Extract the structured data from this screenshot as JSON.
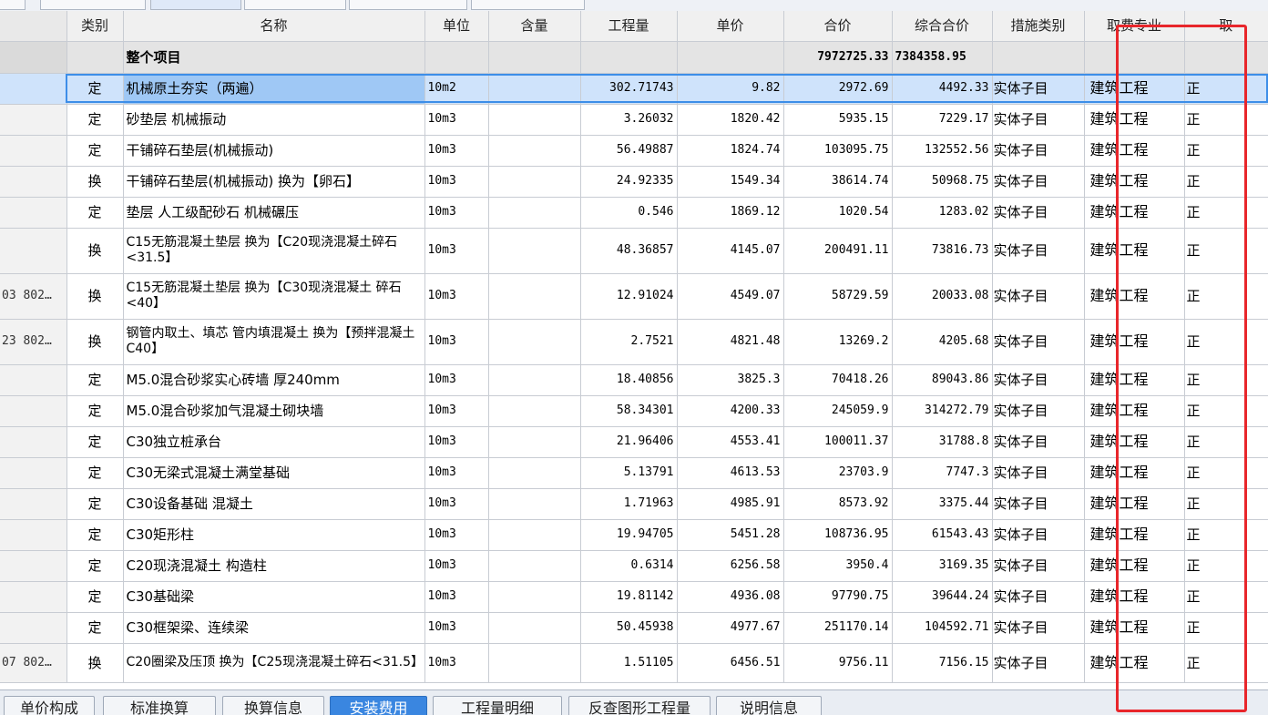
{
  "columns": {
    "category": "类别",
    "name": "名称",
    "unit": "单位",
    "content": "含量",
    "quantity": "工程量",
    "unit_price": "单价",
    "total_price": "合价",
    "combined_total": "综合合价",
    "measure_type": "措施类别",
    "fee_specialty": "取费专业",
    "extra": "取"
  },
  "project_row": {
    "name": "整个项目",
    "total_price": "7972725.33",
    "combined_total": "7384358.95"
  },
  "rows": [
    {
      "idx": "",
      "category": "定",
      "name": "机械原土夯实（两遍）",
      "unit": "10m2",
      "content": "",
      "quantity": "302.71743",
      "unit_price": "9.82",
      "total_price": "2972.69",
      "combined_total": "4492.33",
      "measure_type": "实体子目",
      "fee_specialty": "建筑工程",
      "extra": "正"
    },
    {
      "idx": "",
      "category": "定",
      "name": "砂垫层 机械振动",
      "unit": "10m3",
      "content": "",
      "quantity": "3.26032",
      "unit_price": "1820.42",
      "total_price": "5935.15",
      "combined_total": "7229.17",
      "measure_type": "实体子目",
      "fee_specialty": "建筑工程",
      "extra": "正"
    },
    {
      "idx": "",
      "category": "定",
      "name": "干铺碎石垫层(机械振动)",
      "unit": "10m3",
      "content": "",
      "quantity": "56.49887",
      "unit_price": "1824.74",
      "total_price": "103095.75",
      "combined_total": "132552.56",
      "measure_type": "实体子目",
      "fee_specialty": "建筑工程",
      "extra": "正"
    },
    {
      "idx": "",
      "category": "换",
      "name": "干铺碎石垫层(机械振动)  换为【卵石】",
      "unit": "10m3",
      "content": "",
      "quantity": "24.92335",
      "unit_price": "1549.34",
      "total_price": "38614.74",
      "combined_total": "50968.75",
      "measure_type": "实体子目",
      "fee_specialty": "建筑工程",
      "extra": "正"
    },
    {
      "idx": "",
      "category": "定",
      "name": "垫层 人工级配砂石 机械碾压",
      "unit": "10m3",
      "content": "",
      "quantity": "0.546",
      "unit_price": "1869.12",
      "total_price": "1020.54",
      "combined_total": "1283.02",
      "measure_type": "实体子目",
      "fee_specialty": "建筑工程",
      "extra": "正"
    },
    {
      "idx": "",
      "category": "换",
      "name": "C15无筋混凝土垫层  换为【C20现浇混凝土碎石<31.5】",
      "unit": "10m3",
      "content": "",
      "quantity": "48.36857",
      "unit_price": "4145.07",
      "total_price": "200491.11",
      "combined_total": "73816.73",
      "measure_type": "实体子目",
      "fee_specialty": "建筑工程",
      "extra": "正"
    },
    {
      "idx": "03 802…",
      "category": "换",
      "name": "C15无筋混凝土垫层  换为【C30现浇混凝土 碎石<40】",
      "unit": "10m3",
      "content": "",
      "quantity": "12.91024",
      "unit_price": "4549.07",
      "total_price": "58729.59",
      "combined_total": "20033.08",
      "measure_type": "实体子目",
      "fee_specialty": "建筑工程",
      "extra": "正"
    },
    {
      "idx": "23 802…",
      "category": "换",
      "name": "钢管内取土、填芯 管内填混凝土  换为【预拌混凝土 C40】",
      "unit": "10m3",
      "content": "",
      "quantity": "2.7521",
      "unit_price": "4821.48",
      "total_price": "13269.2",
      "combined_total": "4205.68",
      "measure_type": "实体子目",
      "fee_specialty": "建筑工程",
      "extra": "正"
    },
    {
      "idx": "",
      "category": "定",
      "name": "M5.0混合砂浆实心砖墙 厚240mm",
      "unit": "10m3",
      "content": "",
      "quantity": "18.40856",
      "unit_price": "3825.3",
      "total_price": "70418.26",
      "combined_total": "89043.86",
      "measure_type": "实体子目",
      "fee_specialty": "建筑工程",
      "extra": "正"
    },
    {
      "idx": "",
      "category": "定",
      "name": "M5.0混合砂浆加气混凝土砌块墙",
      "unit": "10m3",
      "content": "",
      "quantity": "58.34301",
      "unit_price": "4200.33",
      "total_price": "245059.9",
      "combined_total": "314272.79",
      "measure_type": "实体子目",
      "fee_specialty": "建筑工程",
      "extra": "正"
    },
    {
      "idx": "",
      "category": "定",
      "name": "C30独立桩承台",
      "unit": "10m3",
      "content": "",
      "quantity": "21.96406",
      "unit_price": "4553.41",
      "total_price": "100011.37",
      "combined_total": "31788.8",
      "measure_type": "实体子目",
      "fee_specialty": "建筑工程",
      "extra": "正"
    },
    {
      "idx": "",
      "category": "定",
      "name": "C30无梁式混凝土满堂基础",
      "unit": "10m3",
      "content": "",
      "quantity": "5.13791",
      "unit_price": "4613.53",
      "total_price": "23703.9",
      "combined_total": "7747.3",
      "measure_type": "实体子目",
      "fee_specialty": "建筑工程",
      "extra": "正"
    },
    {
      "idx": "",
      "category": "定",
      "name": "C30设备基础 混凝土",
      "unit": "10m3",
      "content": "",
      "quantity": "1.71963",
      "unit_price": "4985.91",
      "total_price": "8573.92",
      "combined_total": "3375.44",
      "measure_type": "实体子目",
      "fee_specialty": "建筑工程",
      "extra": "正"
    },
    {
      "idx": "",
      "category": "定",
      "name": "C30矩形柱",
      "unit": "10m3",
      "content": "",
      "quantity": "19.94705",
      "unit_price": "5451.28",
      "total_price": "108736.95",
      "combined_total": "61543.43",
      "measure_type": "实体子目",
      "fee_specialty": "建筑工程",
      "extra": "正"
    },
    {
      "idx": "",
      "category": "定",
      "name": "C20现浇混凝土 构造柱",
      "unit": "10m3",
      "content": "",
      "quantity": "0.6314",
      "unit_price": "6256.58",
      "total_price": "3950.4",
      "combined_total": "3169.35",
      "measure_type": "实体子目",
      "fee_specialty": "建筑工程",
      "extra": "正"
    },
    {
      "idx": "",
      "category": "定",
      "name": "C30基础梁",
      "unit": "10m3",
      "content": "",
      "quantity": "19.81142",
      "unit_price": "4936.08",
      "total_price": "97790.75",
      "combined_total": "39644.24",
      "measure_type": "实体子目",
      "fee_specialty": "建筑工程",
      "extra": "正"
    },
    {
      "idx": "",
      "category": "定",
      "name": "C30框架梁、连续梁",
      "unit": "10m3",
      "content": "",
      "quantity": "50.45938",
      "unit_price": "4977.67",
      "total_price": "251170.14",
      "combined_total": "104592.71",
      "measure_type": "实体子目",
      "fee_specialty": "建筑工程",
      "extra": "正"
    },
    {
      "idx": "07 802…",
      "category": "换",
      "name": "C20圈梁及压顶  换为【C25现浇混凝土碎石<31.5】",
      "unit": "10m3",
      "content": "",
      "quantity": "1.51105",
      "unit_price": "6456.51",
      "total_price": "9756.11",
      "combined_total": "7156.15",
      "measure_type": "实体子目",
      "fee_specialty": "建筑工程",
      "extra": "正"
    }
  ],
  "bottom_tabs": [
    {
      "label": "单价构成"
    },
    {
      "label": "标准换算"
    },
    {
      "label": "换算信息"
    },
    {
      "label": "安装费用"
    },
    {
      "label": "工程量明细"
    },
    {
      "label": "反查图形工程量"
    },
    {
      "label": "说明信息"
    }
  ],
  "active_bottom_tab": "安装费用",
  "colors": {
    "selected_row": "#cfe3fb",
    "active_tab": "#3a86e0",
    "annotation_box": "#e8262b"
  }
}
